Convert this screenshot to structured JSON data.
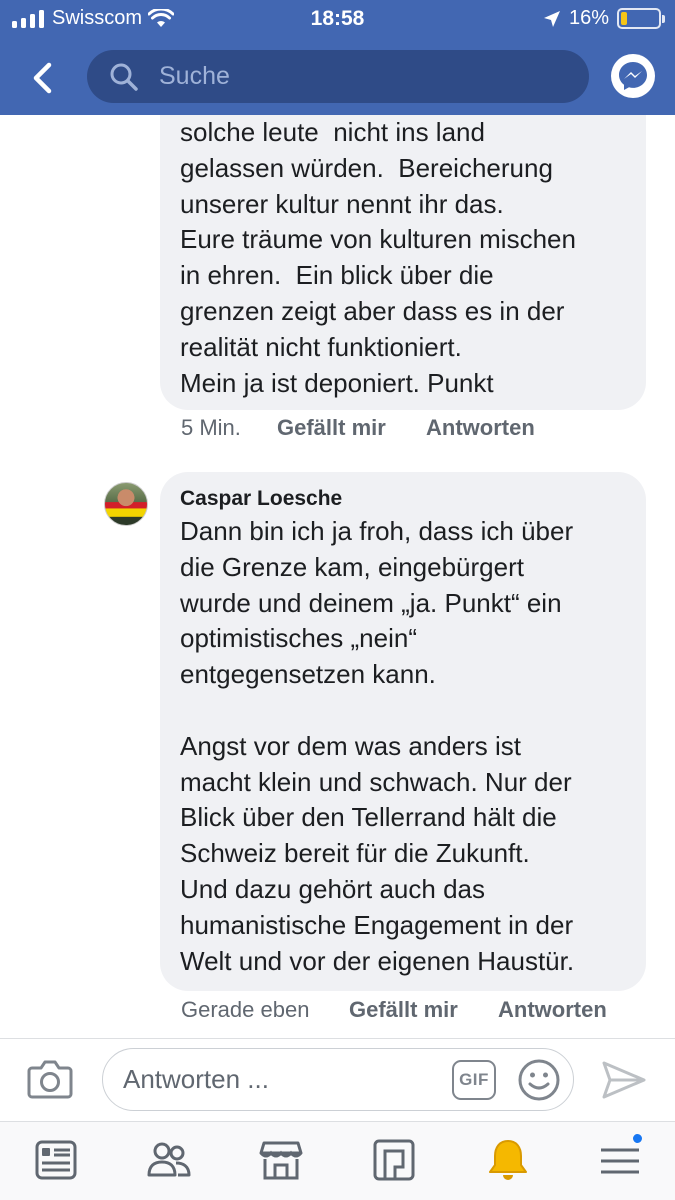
{
  "status_bar": {
    "carrier": "Swisscom",
    "time": "18:58",
    "battery": "16%",
    "battery_level": 0.16
  },
  "header": {
    "search_placeholder": "Suche"
  },
  "comments": [
    {
      "text": "solche leute  nicht ins land\ngelassen würden.  Bereicherung\nunserer kultur nennt ihr das.\nEure träume von kulturen mischen\nin ehren.  Ein blick über die\ngrenzen zeigt aber dass es in der\nrealität nicht funktioniert.\nMein ja ist deponiert. Punkt",
      "time": "5 Min.",
      "like_label": "Gefällt mir",
      "reply_label": "Antworten"
    },
    {
      "author": "Caspar Loesche",
      "text": "Dann bin ich ja froh, dass ich über\ndie Grenze kam, eingebürgert\nwurde und deinem „ja. Punkt“ ein\noptimistisches „nein“\nentgegensetzen kann.\n\nAngst vor dem was anders ist\nmacht klein und schwach. Nur der\nBlick über den Tellerrand hält die\nSchweiz bereit für die Zukunft.\nUnd dazu gehört auch das\nhumanistische Engagement in der\nWelt und vor der eigenen Haustür.",
      "time": "Gerade eben",
      "like_label": "Gefällt mir",
      "reply_label": "Antworten"
    }
  ],
  "reply_bar": {
    "placeholder": "Antworten ...",
    "gif_label": "GIF"
  },
  "tabs": [
    {
      "icon": "news-feed-icon"
    },
    {
      "icon": "friends-icon"
    },
    {
      "icon": "marketplace-icon"
    },
    {
      "icon": "pages-icon"
    },
    {
      "icon": "notifications-bell-icon"
    },
    {
      "icon": "menu-icon"
    }
  ],
  "colors": {
    "brand_blue": "#4267b2",
    "search_bg": "#2f4b87",
    "bubble_bg": "#f0f1f4",
    "bell": "#f5b800",
    "notification_dot": "#1877f2"
  }
}
